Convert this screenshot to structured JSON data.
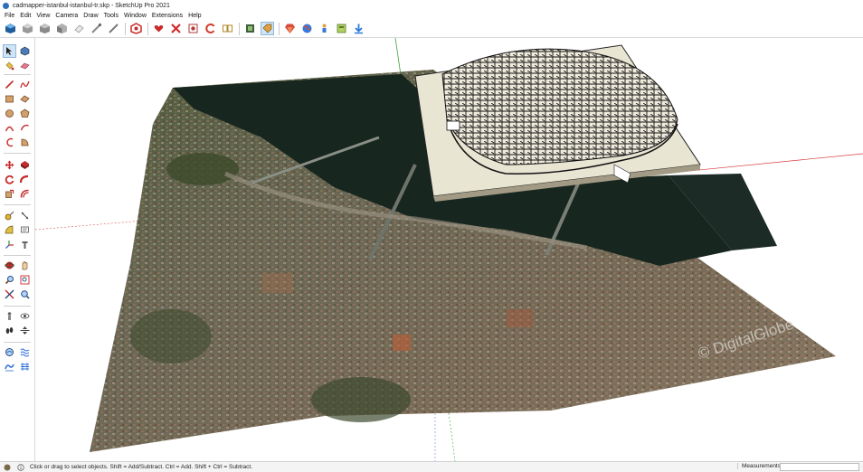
{
  "window": {
    "title": "cadmapper-istanbul-istanbul-tr.skp - SketchUp Pro 2021"
  },
  "menu": [
    "File",
    "Edit",
    "View",
    "Camera",
    "Draw",
    "Tools",
    "Window",
    "Extensions",
    "Help"
  ],
  "toolbar": {
    "icons": [
      "sketchup-logo-icon",
      "iso-view-cube-icon",
      "top-view-cube-icon",
      "front-view-cube-icon",
      "eraser-box-icon",
      "eyedropper-icon",
      "pencil-icon",
      "component-icon",
      "heart-tag-icon",
      "red-x-icon",
      "scenes-icon",
      "orbit-icon",
      "book-icon",
      "layers-icon",
      "tag-active-icon",
      "gem-icon",
      "globe-icon",
      "person-icon",
      "extension-icon",
      "download-icon"
    ]
  },
  "status": {
    "hint": "Click or drag to select objects. Shift = Add/Subtract. Ctrl = Add. Shift + Ctrl = Subtract.",
    "measurements_label": "Measurements",
    "measurements_value": ""
  },
  "viewport": {
    "watermark": "© DigitalGlobe",
    "colors": {
      "axis_red": "#d83a3a",
      "axis_green": "#3aa33a",
      "axis_blue": "#4a6fd8"
    }
  }
}
